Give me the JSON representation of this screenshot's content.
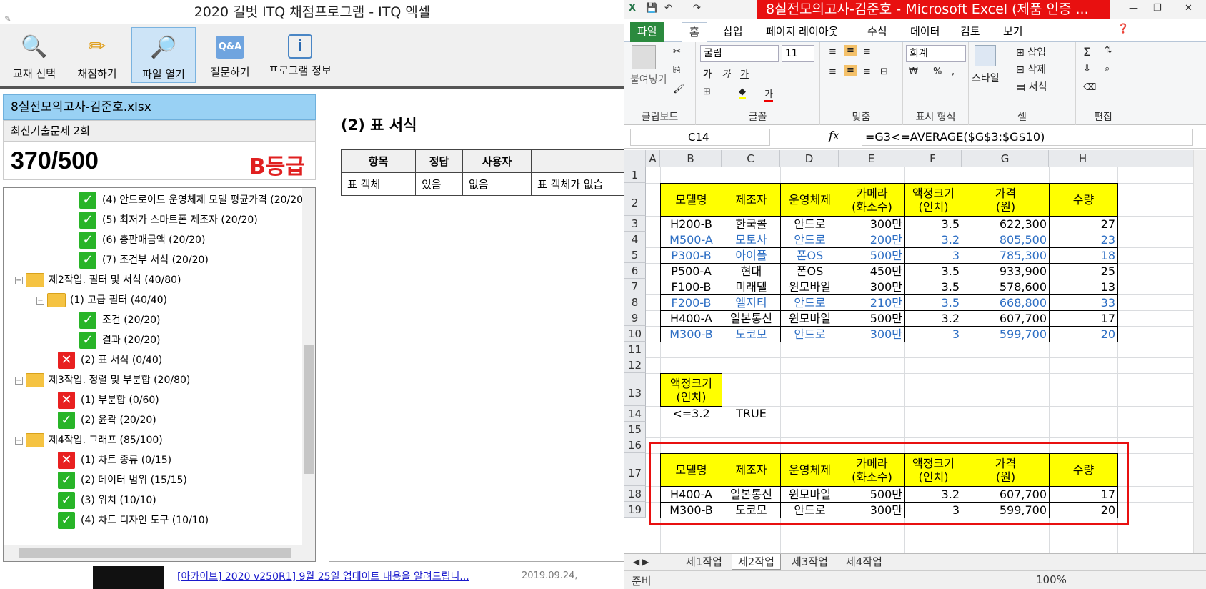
{
  "left": {
    "title": "2020 길벗 ITQ 채점프로그램 - ITQ 엑셀",
    "toolbar": [
      {
        "label": "교재 선택",
        "icon": "magnifier-icon"
      },
      {
        "label": "채점하기",
        "icon": "pencil-icon"
      },
      {
        "label": "파일 열기",
        "icon": "open-file-icon"
      },
      {
        "label": "질문하기",
        "icon": "qa-icon"
      },
      {
        "label": "프로그램 정보",
        "icon": "info-icon"
      }
    ],
    "file_name": "8실전모의고사-김준호.xlsx",
    "exam_name": "최신기출문제 2회",
    "score": "370/500",
    "grade": "B등급",
    "tree": [
      {
        "label": "(4) 안드로이드 운영체제 모델 평균가격 (20/20)",
        "status": "ok"
      },
      {
        "label": "(5) 최저가 스마트폰 제조자 (20/20)",
        "status": "ok"
      },
      {
        "label": "(6) 총판매금액 (20/20)",
        "status": "ok"
      },
      {
        "label": "(7) 조건부 서식 (20/20)",
        "status": "ok"
      },
      {
        "label": "제2작업. 필터 및 서식 (40/80)",
        "status": "folder"
      },
      {
        "label": "(1) 고급 필터 (40/40)",
        "status": "folder"
      },
      {
        "label": "조건 (20/20)",
        "status": "ok"
      },
      {
        "label": "결과 (20/20)",
        "status": "ok"
      },
      {
        "label": "(2) 표 서식 (0/40)",
        "status": "fail"
      },
      {
        "label": "제3작업. 정렬 및 부분합 (20/80)",
        "status": "folder"
      },
      {
        "label": "(1) 부분합 (0/60)",
        "status": "fail"
      },
      {
        "label": "(2) 윤곽 (20/20)",
        "status": "ok"
      },
      {
        "label": "제4작업. 그래프 (85/100)",
        "status": "folder"
      },
      {
        "label": "(1) 차트 종류 (0/15)",
        "status": "fail"
      },
      {
        "label": "(2) 데이터 범위 (15/15)",
        "status": "ok"
      },
      {
        "label": "(3) 위치 (10/10)",
        "status": "ok"
      },
      {
        "label": "(4) 차트 디자인 도구 (10/10)",
        "status": "ok"
      }
    ],
    "detail": {
      "title": "(2) 표 서식",
      "headers": [
        "항목",
        "정답",
        "사용자",
        ""
      ],
      "row": [
        "표 객체",
        "있음",
        "없음",
        "표 객체가 없습"
      ]
    },
    "footer_link": "[아카이브] 2020 v250R1] 9월 25일 업데이트 내용을 알려드립니...",
    "footer_date": "2019.09.24,"
  },
  "excel": {
    "window_title": "8실전모의고사-김준호 - Microsoft Excel (제품 인증 ...",
    "tabs": [
      "파일",
      "홈",
      "삽입",
      "페이지 레이아웃",
      "수식",
      "데이터",
      "검토",
      "보기"
    ],
    "ribbon": {
      "paste": "붙여넣기",
      "font_name": "굴림",
      "font_size": "11",
      "number_format": "회계",
      "style": "스타일",
      "insert": "삽입",
      "delete": "삭제",
      "format": "서식",
      "groups": [
        "클립보드",
        "글꼴",
        "맞춤",
        "표시 형식",
        "셀",
        "편집"
      ]
    },
    "name_box": "C14",
    "formula": "=G3<=AVERAGE($G$3:$G$10)",
    "columns": [
      "A",
      "B",
      "C",
      "D",
      "E",
      "F",
      "G",
      "H"
    ],
    "rows": [
      "1",
      "2",
      "3",
      "4",
      "5",
      "6",
      "7",
      "8",
      "9",
      "10",
      "11",
      "12",
      "13",
      "14",
      "15",
      "16",
      "17",
      "18",
      "19"
    ],
    "headers": [
      "모델명",
      "제조자",
      "운영체제",
      "카메라\n(화소수)",
      "액정크기\n(인치)",
      "가격\n(원)",
      "수량"
    ],
    "data": [
      [
        "H200-B",
        "한국콜",
        "안드로",
        "300만",
        "3.5",
        "622,300",
        "27"
      ],
      [
        "M500-A",
        "모토사",
        "안드로",
        "200만",
        "3.2",
        "805,500",
        "23"
      ],
      [
        "P300-B",
        "아이플",
        "폰OS",
        "500만",
        "3",
        "785,300",
        "18"
      ],
      [
        "P500-A",
        "현대",
        "폰OS",
        "450만",
        "3.5",
        "933,900",
        "25"
      ],
      [
        "F100-B",
        "미래텔",
        "윈모바일",
        "300만",
        "3.5",
        "578,600",
        "13"
      ],
      [
        "F200-B",
        "엘지티",
        "안드로",
        "210만",
        "3.5",
        "668,800",
        "33"
      ],
      [
        "H400-A",
        "일본통신",
        "윈모바일",
        "500만",
        "3.2",
        "607,700",
        "17"
      ],
      [
        "M300-B",
        "도코모",
        "안드로",
        "300만",
        "3",
        "599,700",
        "20"
      ]
    ],
    "blue_rows": [
      1,
      2,
      5,
      7
    ],
    "criteria_header": "액정크기\n(인치)",
    "criteria_value": "<=3.2",
    "criteria_result": "TRUE",
    "filtered": [
      [
        "H400-A",
        "일본통신",
        "윈모바일",
        "500만",
        "3.2",
        "607,700",
        "17"
      ],
      [
        "M300-B",
        "도코모",
        "안드로",
        "300만",
        "3",
        "599,700",
        "20"
      ]
    ],
    "sheets": [
      "제1작업",
      "제2작업",
      "제3작업",
      "제4작업"
    ],
    "status": "준비",
    "zoom": "100%",
    "colors": {
      "header_fill": "#ffff00",
      "blue_text": "#2e6fc4",
      "highlight": "#e81010"
    }
  }
}
